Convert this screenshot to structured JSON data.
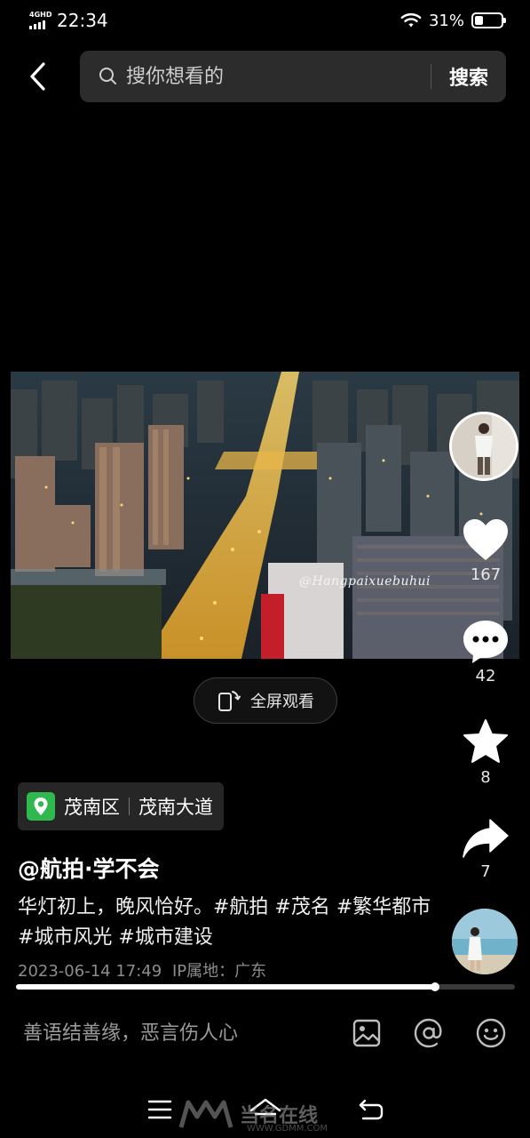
{
  "status_bar": {
    "network": "4GHD",
    "time": "22:34",
    "battery": "31%",
    "battery_level": 0.31
  },
  "search": {
    "placeholder": "搜你想看的",
    "button_label": "搜索"
  },
  "video": {
    "watermark": "@Hangpaixuebuhui",
    "progress": 0.84,
    "fullscreen_label": "全屏观看"
  },
  "actions": {
    "likes": "167",
    "comments": "42",
    "favorites": "8",
    "shares": "7"
  },
  "location": {
    "district": "茂南区",
    "road": "茂南大道"
  },
  "post": {
    "author": "@航拍·学不会",
    "description": "华灯初上，晚风恰好。#航拍 #茂名 #繁华都市 #城市风光 #城市建设",
    "datetime": "2023-06-14 17:49",
    "ip_location": "IP属地：广东"
  },
  "comment_bar": {
    "placeholder": "善语结善缘，恶言伤人心"
  },
  "site_watermark": {
    "name": "当名在线",
    "url": "WWW.GDMM.COM"
  },
  "colors": {
    "background": "#000000",
    "location_pin": "#2fb84d",
    "panel": "#262626"
  }
}
